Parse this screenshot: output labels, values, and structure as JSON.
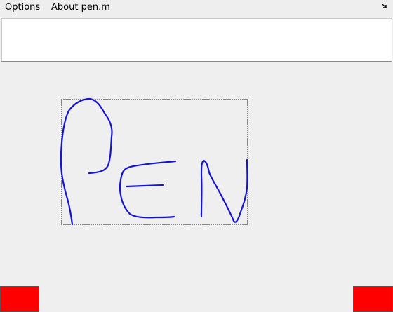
{
  "menubar": {
    "options_accel": "O",
    "options_rest": "ptions",
    "about_accel": "A",
    "about_rest": "bout pen.m",
    "dock_icon": "dock-arrow-icon"
  },
  "text_field": {
    "value": ""
  },
  "canvas": {
    "stroke_color": "#1414d4",
    "frame": "dotted-bounding-box"
  },
  "buttons": {
    "left_color": "#ff0000",
    "right_color": "#ff0000"
  }
}
